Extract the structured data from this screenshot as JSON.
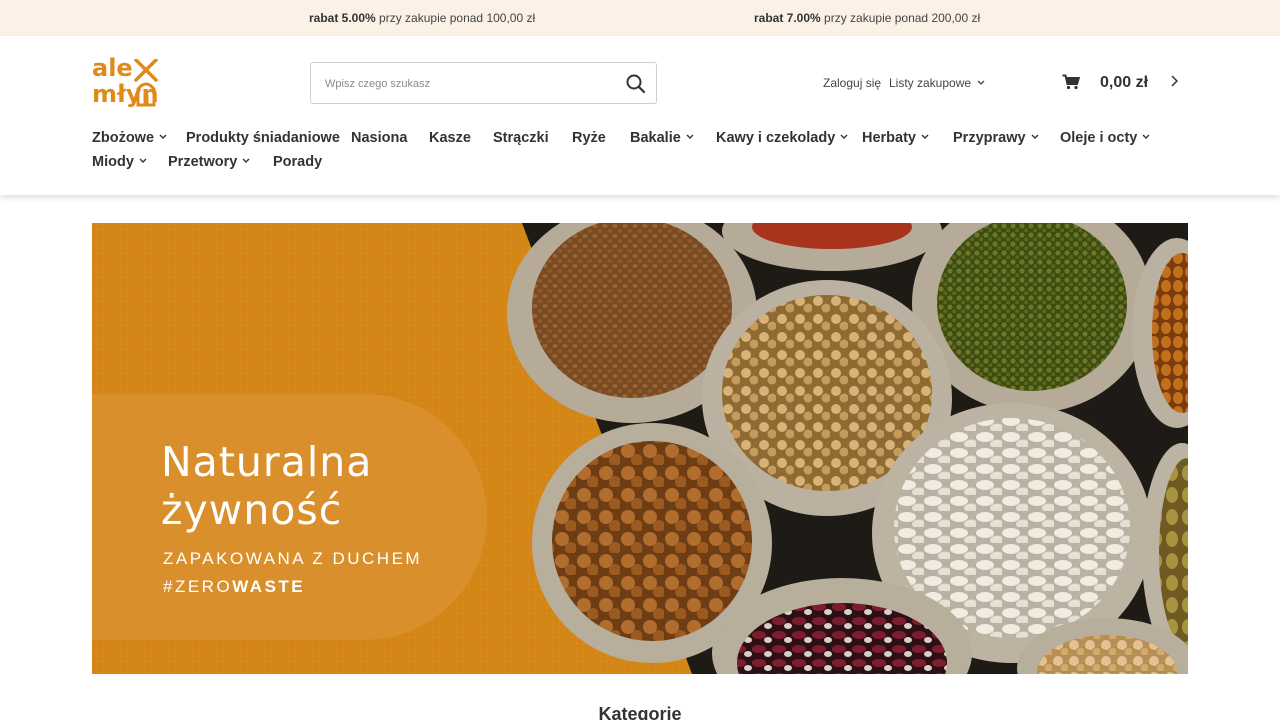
{
  "promo": {
    "p1_bold": "rabat 5.00%",
    "p1_text": " przy zakupie ponad 100,00 zł",
    "p2_bold": "rabat 7.00%",
    "p2_text": " przy zakupie ponad 200,00 zł"
  },
  "logo": {
    "line1": "ale",
    "line2": "młyn"
  },
  "search": {
    "placeholder": "Wpisz czego szukasz",
    "icon": "search-icon"
  },
  "account": {
    "login": "Zaloguj się",
    "lists": "Listy zakupowe"
  },
  "cart": {
    "amount": "0,00 zł",
    "icon": "cart-icon"
  },
  "nav": {
    "items": [
      {
        "label": "Zbożowe",
        "dropdown": true
      },
      {
        "label": "Produkty śniadaniowe",
        "dropdown": false
      },
      {
        "label": "Nasiona",
        "dropdown": false
      },
      {
        "label": "Kasze",
        "dropdown": false
      },
      {
        "label": "Strączki",
        "dropdown": false
      },
      {
        "label": "Ryże",
        "dropdown": false
      },
      {
        "label": "Bakalie",
        "dropdown": true
      },
      {
        "label": "Kawy i czekolady",
        "dropdown": true
      },
      {
        "label": "Herbaty",
        "dropdown": true
      },
      {
        "label": "Przyprawy",
        "dropdown": true
      },
      {
        "label": "Oleje i octy",
        "dropdown": true
      },
      {
        "label": "Miody",
        "dropdown": true
      },
      {
        "label": "Przetwory",
        "dropdown": true
      },
      {
        "label": "Porady",
        "dropdown": false
      }
    ]
  },
  "hero": {
    "title_line1": "Naturalna",
    "title_line2": "żywność",
    "subtitle": "ZAPAKOWANA Z DUCHEM",
    "tag_prefix": "#ZERO",
    "tag_bold": "WASTE"
  },
  "section": {
    "title": "Kategorie"
  },
  "colors": {
    "brand": "#e08a19",
    "promo_bg": "#fcf1e6",
    "hero_bg": "#d48716",
    "text": "#333333"
  }
}
